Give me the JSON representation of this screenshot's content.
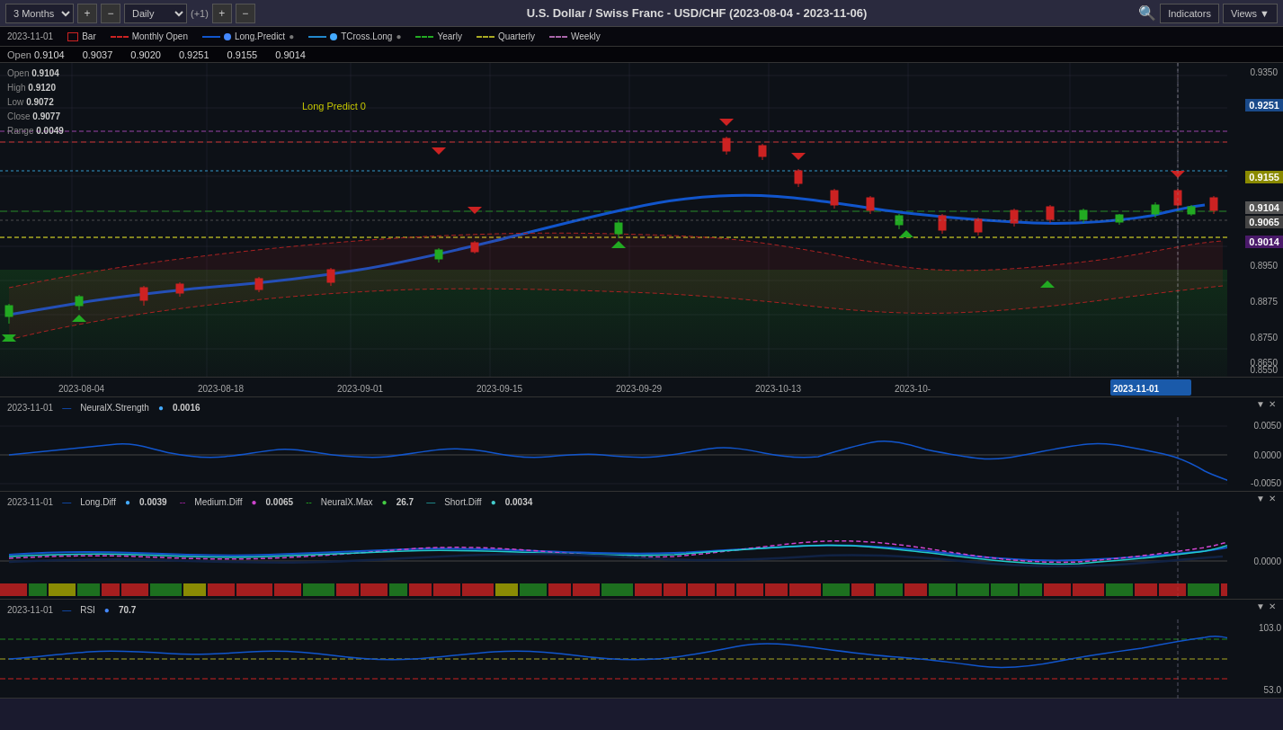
{
  "toolbar": {
    "period": "3 Months",
    "interval": "Daily",
    "nav_label": "(+1)",
    "indicators_label": "Indicators",
    "views_label": "Views",
    "title": "U.S. Dollar / Swiss Franc - USD/CHF (2023-08-04 - 2023-11-06)",
    "search_icon": "🔍"
  },
  "legend": {
    "date": "2023-11-01",
    "items": [
      {
        "name": "Bar",
        "color": "#cc2222",
        "type": "box"
      },
      {
        "name": "Monthly Open",
        "color": "#cc2222",
        "type": "dashed"
      },
      {
        "name": "Long.Predict",
        "color": "#1155cc",
        "type": "solid",
        "dot": true
      },
      {
        "name": "TCross.Long",
        "color": "#2288cc",
        "type": "solid",
        "dot": true
      },
      {
        "name": "Yearly",
        "color": "#22aa22",
        "type": "dashed"
      },
      {
        "name": "Quarterly",
        "color": "#aaaa00",
        "type": "dashed"
      },
      {
        "name": "Weekly",
        "color": "#aa44aa",
        "type": "dashed"
      }
    ]
  },
  "ohlc": {
    "open_label": "Open",
    "high_label": "High",
    "low_label": "Low",
    "close_label": "Close",
    "range_label": "Range",
    "open": "0.9104",
    "high": "0.9120",
    "low": "0.9072",
    "close": "0.9077",
    "range": "0.0049",
    "open_ref1": "0.9104",
    "open_ref2": "0.9037",
    "open_ref3": "0.9020",
    "open_ref4": "0.9251",
    "open_ref5": "0.9155",
    "open_ref6": "0.9014"
  },
  "y_axis": {
    "labels": [
      "0.9350",
      "0.9250",
      "0.9155",
      "0.9104",
      "0.9065",
      "0.9014",
      "0.8950",
      "0.8875",
      "0.8750",
      "0.8650",
      "0.8550"
    ],
    "highlights": [
      {
        "value": "0.9251",
        "class": "y-label-blue"
      },
      {
        "value": "0.9155",
        "class": "y-label-yellow"
      },
      {
        "value": "0.9104",
        "class": "y-label-gray"
      },
      {
        "value": "0.9065",
        "class": "y-label-gray"
      },
      {
        "value": "0.9014",
        "class": "y-label-purple"
      }
    ]
  },
  "x_axis": {
    "dates": [
      "2023-08-04",
      "2023-08-18",
      "2023-09-01",
      "2023-09-15",
      "2023-09-29",
      "2023-10-13",
      "2023-11-01"
    ]
  },
  "indicator1": {
    "name": "NeuralX.Strength",
    "date": "2023-11-01",
    "value": "0.0016",
    "y_labels": [
      "0.0050",
      "0.0000",
      "-0.0050"
    ]
  },
  "indicator2": {
    "name": "",
    "date": "2023-11-01",
    "items": [
      {
        "name": "Long.Diff",
        "color": "#1155cc",
        "type": "solid",
        "dot": true,
        "value": "0.0039"
      },
      {
        "name": "Medium.Diff",
        "color": "#aa22aa",
        "type": "dashed",
        "dot": true,
        "value": "0.0065"
      },
      {
        "name": "NeuralX.Max",
        "color": "#22aa22",
        "type": "dashed",
        "dot": true,
        "value": "26.7"
      },
      {
        "name": "Short.Diff",
        "color": "#22aaaa",
        "type": "solid",
        "dot": true,
        "value": "0.0034"
      }
    ],
    "y_label": "0.0000"
  },
  "indicator3": {
    "name": "RSI",
    "date": "2023-11-01",
    "dot_color": "#4488ff",
    "value": "70.7",
    "y_labels": [
      "103.0",
      "53.0"
    ]
  },
  "long_predict": {
    "label": "Long Predict 0"
  }
}
